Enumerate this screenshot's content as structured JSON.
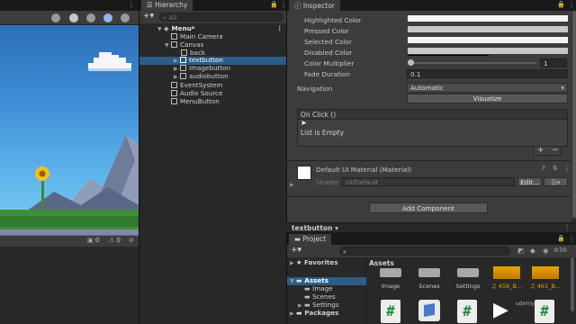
{
  "scene": {
    "status_counts": [
      "0",
      "0"
    ]
  },
  "hierarchy": {
    "tab": "Hierarchy",
    "search_placeholder": "All",
    "items": [
      {
        "label": "Menu*"
      },
      {
        "label": "Main Camera"
      },
      {
        "label": "Canvas"
      },
      {
        "label": "back"
      },
      {
        "label": "textbutton"
      },
      {
        "label": "Imagebutton"
      },
      {
        "label": "audiobutton"
      },
      {
        "label": "EventSystem"
      },
      {
        "label": "Audio Source"
      },
      {
        "label": "MenuButton"
      }
    ]
  },
  "inspector": {
    "tab": "Inspector",
    "colors": [
      {
        "label": "Highlighted Color"
      },
      {
        "label": "Pressed Color"
      },
      {
        "label": "Selected Color"
      },
      {
        "label": "Disabled Color"
      }
    ],
    "color_multiplier_label": "Color Multiplier",
    "color_multiplier_value": "1",
    "fade_duration_label": "Fade Duration",
    "fade_duration_value": "0.1",
    "navigation_label": "Navigation",
    "navigation_value": "Automatic",
    "visualize_label": "Visualize",
    "onclick_label": "On Click ()",
    "list_empty": "List is Empty",
    "material_name": "Default UI Material (Material)",
    "shader_label": "Shader",
    "shader_value": "UI/Default",
    "edit_label": "Edit...",
    "add_component": "Add Component",
    "footer_label": "textbutton"
  },
  "project": {
    "tab": "Project",
    "search_count": "30",
    "favorites": "Favorites",
    "assets": "Assets",
    "folders": [
      "Image",
      "Scenes",
      "Settings"
    ],
    "packages": "Packages",
    "assets_header": "Assets",
    "grid_labels": [
      "Image",
      "Scenes",
      "Settings",
      "456_B...",
      "461_B..."
    ],
    "watermark": "udemy"
  }
}
